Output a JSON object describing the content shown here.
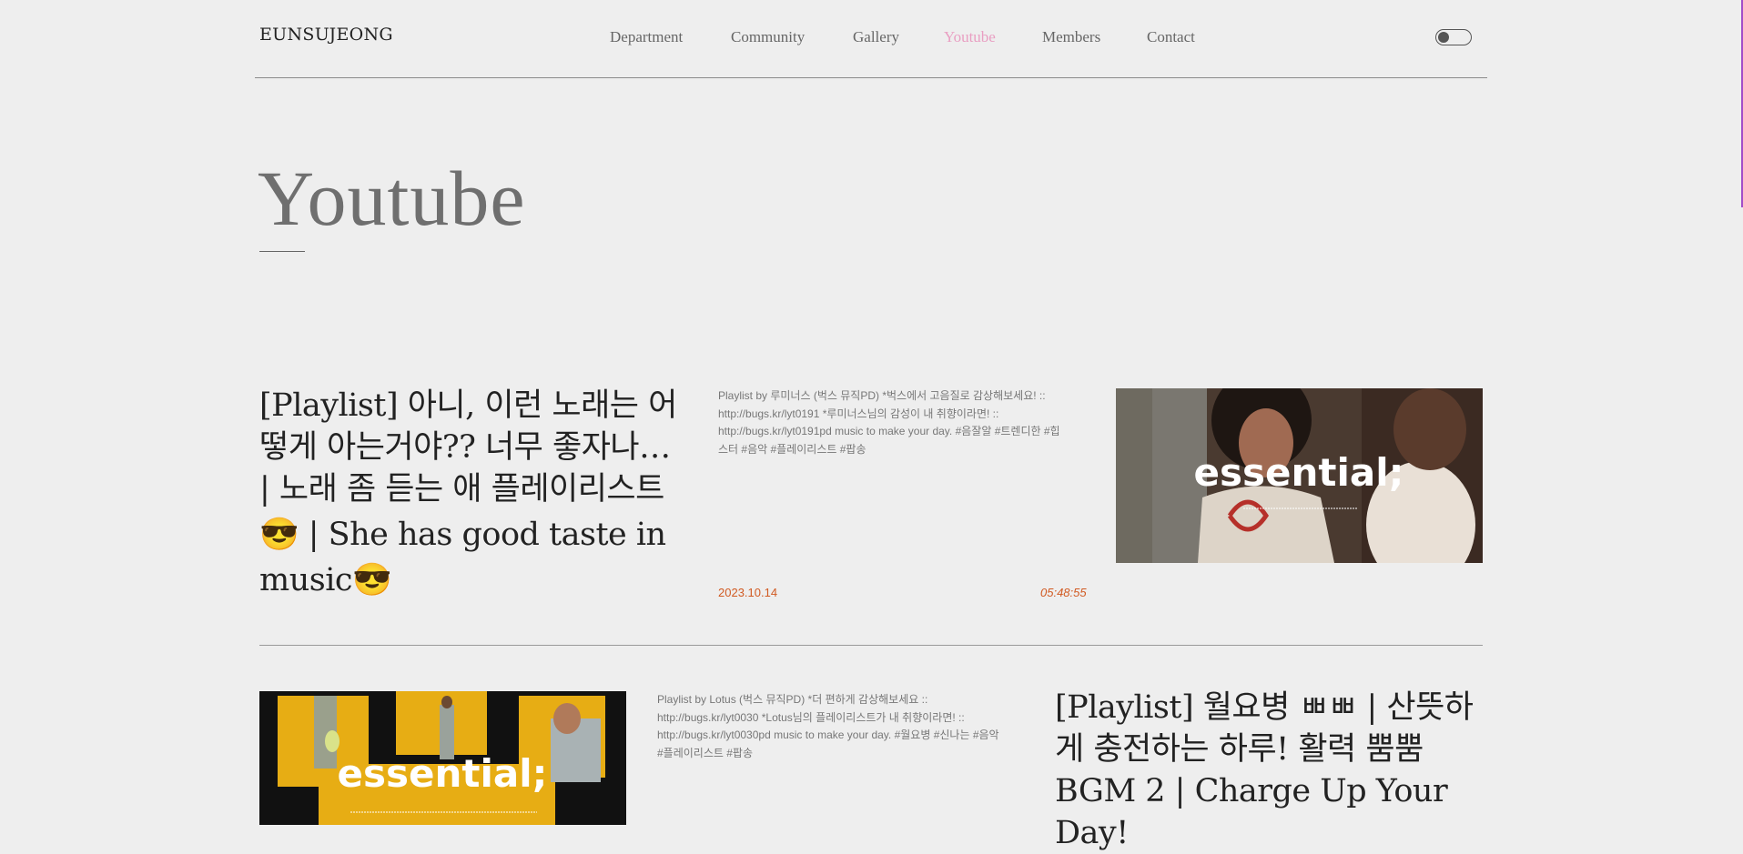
{
  "header": {
    "logo": "EUNSUJEONG",
    "nav": [
      {
        "label": "Department",
        "active": false
      },
      {
        "label": "Community",
        "active": false
      },
      {
        "label": "Gallery",
        "active": false
      },
      {
        "label": "Youtube",
        "active": true
      },
      {
        "label": "Members",
        "active": false
      },
      {
        "label": "Contact",
        "active": false
      }
    ],
    "theme_toggle": {
      "state": "off"
    }
  },
  "page": {
    "title": "Youtube"
  },
  "videos": [
    {
      "title_line1": "[Playlist] 아니, 이런 노래는 어",
      "title_line2": "떻게 아는거야?? 너무 좋자나…",
      "title_line3": "| 노래 좀 듣는 애 플레이리스트",
      "title_line4": "😎 | She has good taste in",
      "title_line5": "music😎",
      "description_line1": "Playlist by 루미너스 (벅스 뮤직PD) *벅스에서 고음질로 감상해보세요! ::",
      "description_line2": "http://bugs.kr/lyt0191 *루미너스님의 감성이 내 취향이라면! ::",
      "description_line3": "http://bugs.kr/lyt0191pd music to make your day. #음잘알 #트렌디한 #힙",
      "description_line4": "스터 #음악 #플레이리스트 #팝송",
      "date": "2023.10.14",
      "duration": "05:48:55",
      "thumbnail_text": "essential;"
    },
    {
      "title_line1": "[Playlist] 월요병 ㅃㅃ | 산뜻하",
      "title_line2": "게 충전하는 하루! 활력 뿜뿜",
      "title_line3": "BGM 2 | Charge Up Your",
      "title_line4": "Day!",
      "description_line1": "Playlist by Lotus (벅스 뮤직PD) *더 편하게 감상해보세요 ::",
      "description_line2": "http://bugs.kr/lyt0030 *Lotus님의 플레이리스트가 내 취향이라면! ::",
      "description_line3": "http://bugs.kr/lyt0030pd music to make your day. #월요병 #신나는 #음악",
      "description_line4": "#플레이리스트 #팝송",
      "thumbnail_text": "essential;"
    }
  ],
  "colors": {
    "background": "#eeeeee",
    "nav_active": "#e99ec2",
    "meta_accent": "#d15a22",
    "thumbnail_yellow": "#e7ad14"
  }
}
